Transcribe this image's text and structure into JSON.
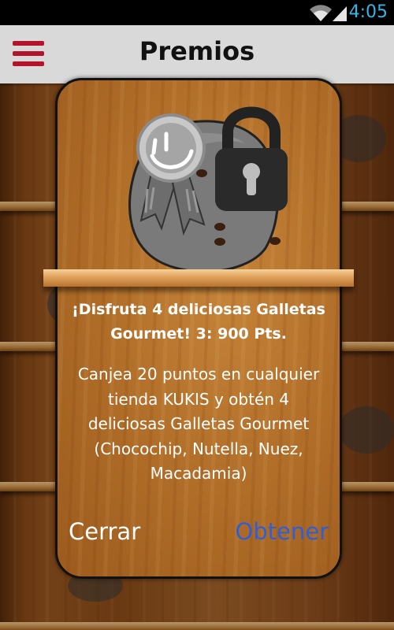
{
  "status_bar": {
    "time": "4:05"
  },
  "header": {
    "title": "Premios",
    "menu_icon": "hamburger-menu-icon"
  },
  "dialog": {
    "title": "¡Disfruta 4 deliciosas Galletas Gourmet! 3: 900 Pts.",
    "description": "Canjea 20 puntos en cualquier tienda KUKIS y obtén 4 deliciosas Galletas Gourmet (Chocochip, Nutella, Nuez, Macadamia)",
    "close_label": "Cerrar",
    "obtain_label": "Obtener",
    "reward_state": "locked"
  },
  "colors": {
    "accent_red": "#b3142b",
    "link_blue": "#2f5fd6",
    "clock_blue": "#33b5e5"
  }
}
